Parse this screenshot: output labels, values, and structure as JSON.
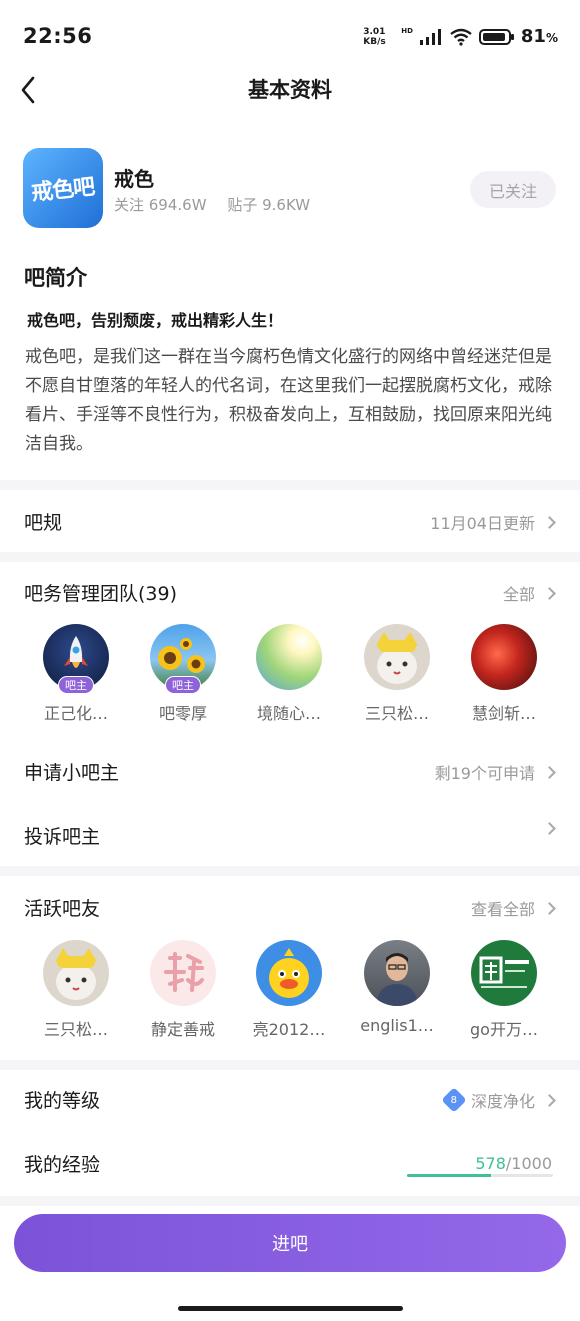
{
  "status_bar": {
    "time": "22:56",
    "net_speed_value": "3.01",
    "net_speed_unit": "KB/s",
    "hd": "HD",
    "battery_percent": "81",
    "battery_unit": "%"
  },
  "nav": {
    "title": "基本资料"
  },
  "forum": {
    "logo_text": "戒色吧",
    "name": "戒色",
    "followers": "关注 694.6W",
    "posts": "贴子 9.6KW",
    "follow_button": "已关注"
  },
  "intro": {
    "heading": "吧简介",
    "slogan": "戒色吧，告别颓废，戒出精彩人生！",
    "body": "戒色吧，是我们这一群在当今腐朽色情文化盛行的网络中曾经迷茫但是不愿自甘堕落的年轻人的代名词，在这里我们一起摆脱腐朽文化，戒除看片、手淫等不良性行为，积极奋发向上，互相鼓励，找回原来阳光纯洁自我。"
  },
  "rules": {
    "label": "吧规",
    "updated": "11月04日更新"
  },
  "team": {
    "label": "吧务管理团队(39)",
    "all": "全部",
    "members": [
      {
        "name": "正己化…",
        "badge": "吧主",
        "icon": "rocket-avatar",
        "color": "#1b2c5a"
      },
      {
        "name": "吧零厚",
        "badge": "吧主",
        "icon": "sunflower-avatar",
        "color": "#5aa8e8"
      },
      {
        "name": "境随心…",
        "badge": "",
        "icon": "sunlight-avatar",
        "color": "#a9d98a"
      },
      {
        "name": "三只松…",
        "badge": "",
        "icon": "cat-avatar",
        "color": "#d9d2c8"
      },
      {
        "name": "慧剑斩…",
        "badge": "",
        "icon": "red-lights-avatar",
        "color": "#c9302a"
      }
    ]
  },
  "apply": {
    "label": "申请小吧主",
    "remaining": "剩19个可申请"
  },
  "complain": {
    "label": "投诉吧主"
  },
  "active": {
    "label": "活跃吧友",
    "view_all": "查看全部",
    "members": [
      {
        "name": "三只松…",
        "icon": "cat-avatar",
        "color": "#d9d2c8"
      },
      {
        "name": "静定善戒",
        "icon": "calligraphy-avatar",
        "color": "#fbe6e6"
      },
      {
        "name": "亮2012…",
        "icon": "yellow-bird-avatar",
        "color": "#3e8ee6"
      },
      {
        "name": "englis1…",
        "icon": "person-avatar",
        "color": "#6b6f75"
      },
      {
        "name": "go开万…",
        "icon": "green-logo-avatar",
        "color": "#1f7a3c"
      }
    ]
  },
  "level": {
    "label": "我的等级",
    "number": "8",
    "name": "深度净化"
  },
  "experience": {
    "label": "我的经验",
    "current": "578",
    "total": "/1000",
    "progress": 0.578
  },
  "enter_button": "进吧"
}
